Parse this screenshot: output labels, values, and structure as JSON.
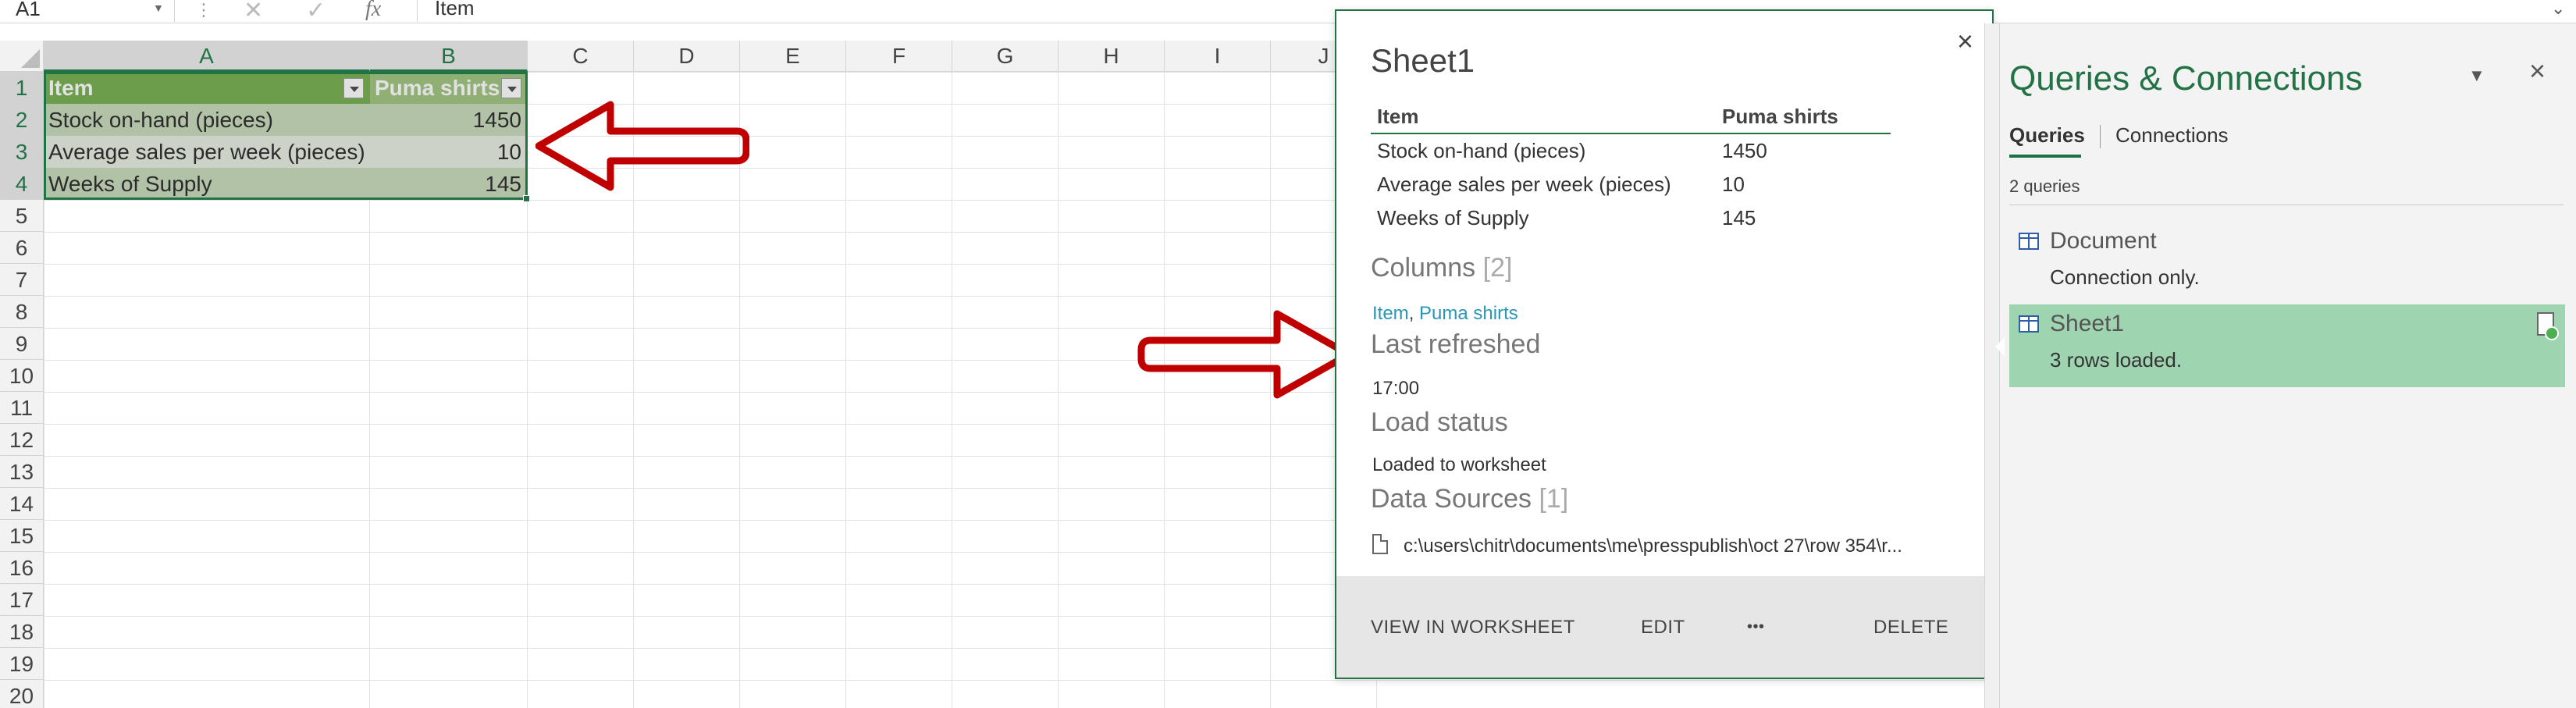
{
  "formula_bar": {
    "name_box": "A1",
    "content": "Item"
  },
  "grid": {
    "columns": [
      "A",
      "B",
      "C",
      "D",
      "E",
      "F",
      "G",
      "H",
      "I",
      "J"
    ],
    "rows": [
      "1",
      "2",
      "3",
      "4",
      "5",
      "6",
      "7",
      "8",
      "9",
      "10",
      "11",
      "12",
      "13",
      "14",
      "15",
      "16",
      "17",
      "18",
      "19",
      "20"
    ],
    "selected_columns": [
      "A",
      "B"
    ],
    "selected_rows": [
      "1",
      "2",
      "3",
      "4"
    ]
  },
  "table": {
    "headers": [
      "Item",
      "Puma shirts"
    ],
    "rows": [
      [
        "Stock on-hand (pieces)",
        "1450"
      ],
      [
        "Average sales per week (pieces)",
        "10"
      ],
      [
        "Weeks of Supply",
        "145"
      ]
    ]
  },
  "popup": {
    "title": "Sheet1",
    "close": "×",
    "preview_headers": [
      "Item",
      "Puma shirts"
    ],
    "preview_rows": [
      [
        "Stock on-hand (pieces)",
        "1450"
      ],
      [
        "Average sales per week (pieces)",
        "10"
      ],
      [
        "Weeks of Supply",
        "145"
      ]
    ],
    "columns_title": "Columns",
    "columns_count": "[2]",
    "columns_links": [
      "Item",
      "Puma shirts"
    ],
    "columns_separator": ", ",
    "last_refreshed_title": "Last refreshed",
    "last_refreshed_value": "17:00",
    "load_status_title": "Load status",
    "load_status_value": "Loaded to worksheet",
    "data_sources_title": "Data Sources",
    "data_sources_count": "[1]",
    "data_source_path": "c:\\users\\chitr\\documents\\me\\presspublish\\oct 27\\row 354\\r...",
    "footer": {
      "view_in_worksheet": "VIEW IN WORKSHEET",
      "edit": "EDIT",
      "more": "•••",
      "delete": "DELETE"
    }
  },
  "pane": {
    "title": "Queries & Connections",
    "options_icon": "chevron-down-icon",
    "close": "×",
    "tabs": [
      "Queries",
      "Connections"
    ],
    "query_count": "2 queries",
    "queries": [
      {
        "name": "Document",
        "status": "Connection only.",
        "selected": false
      },
      {
        "name": "Sheet1",
        "status": "3 rows loaded.",
        "selected": true
      }
    ]
  },
  "colors": {
    "excel_green": "#217346",
    "table_header": "#70ad47",
    "selected_query": "#9fd4b1",
    "arrow_red": "#c00000",
    "link_blue": "#2896b7"
  }
}
